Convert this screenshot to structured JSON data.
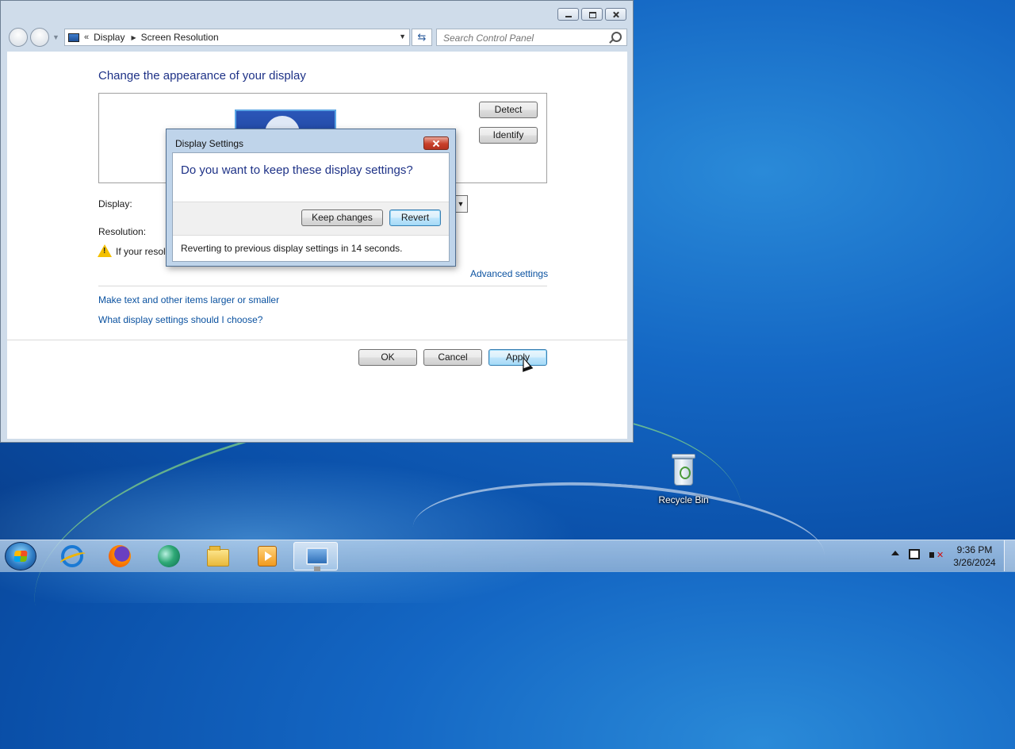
{
  "window": {
    "address": {
      "crumbs": [
        "Display",
        "Screen Resolution"
      ],
      "chevron": "«"
    },
    "search": {
      "placeholder": "Search Control Panel"
    }
  },
  "content": {
    "heading": "Change the appearance of your display",
    "detect_label": "Detect",
    "identify_label": "Identify",
    "display_label": "Display:",
    "resolution_label": "Resolution:",
    "warning_text": "If your resolu",
    "advanced_link": "Advanced settings",
    "link_larger_text": "Make text and other items larger or smaller",
    "link_which_settings": "What display settings should I choose?",
    "ok_label": "OK",
    "cancel_label": "Cancel",
    "apply_label": "Apply"
  },
  "dialog": {
    "title": "Display Settings",
    "question": "Do you want to keep these display settings?",
    "keep_label": "Keep changes",
    "revert_label": "Revert",
    "footer": "Reverting to previous display settings in 14 seconds.",
    "countdown_seconds": 14
  },
  "desktop": {
    "recycle_bin_label": "Recycle Bin"
  },
  "taskbar": {
    "items": [
      "start-icon",
      "internet-explorer-icon",
      "firefox-icon",
      "edge-icon",
      "file-explorer-icon",
      "media-player-icon",
      "control-panel-icon"
    ],
    "active_item": "control-panel-icon",
    "clock_time": "9:36 PM",
    "clock_date": "3/26/2024"
  },
  "colors": {
    "heading_blue": "#1e3287",
    "link_blue": "#0b52a0",
    "close_red": "#c8402a"
  }
}
